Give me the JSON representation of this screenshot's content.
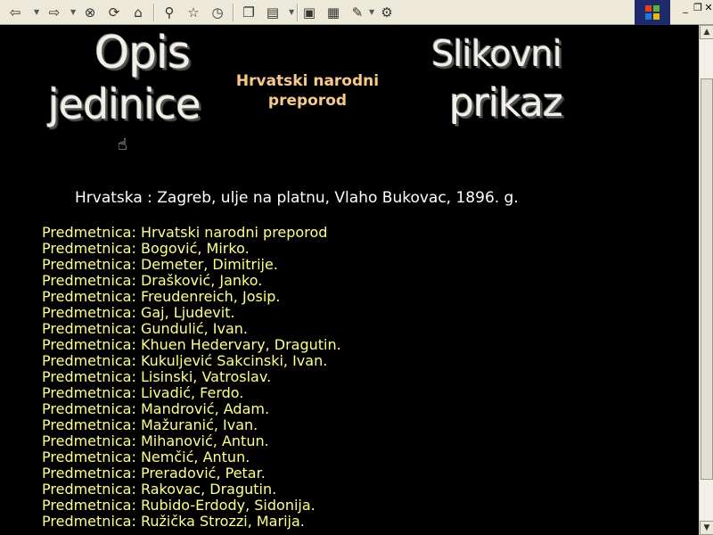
{
  "toolbar": {
    "buttons": [
      "back-icon",
      "forward-icon",
      "stop-icon",
      "refresh-icon",
      "home-icon",
      "search-icon",
      "favorites-icon",
      "history-icon",
      "copy-icon",
      "format-icon",
      "window-icon",
      "folder-icon",
      "edit-icon",
      "tools-icon"
    ]
  },
  "header": {
    "left_title_line1": "Opis",
    "left_title_line2": "jedinice",
    "center_title_line1": "Hrvatski narodni",
    "center_title_line2": "preporod",
    "right_title_line1": "Slikovni",
    "right_title_line2": "prikaz"
  },
  "description": "Hrvatska : Zagreb, ulje na platnu, Vlaho Bukovac, 1896. g.",
  "subjects": [
    "Predmetnica: Hrvatski narodni preporod",
    "Predmetnica: Bogović, Mirko.",
    "Predmetnica: Demeter, Dimitrije.",
    "Predmetnica: Drašković, Janko.",
    "Predmetnica: Freudenreich, Josip.",
    "Predmetnica: Gaj, Ljudevit.",
    "Predmetnica: Gundulić, Ivan.",
    "Predmetnica: Khuen Hedervary, Dragutin.",
    "Predmetnica: Kukuljević Sakcinski, Ivan.",
    "Predmetnica: Lisinski, Vatroslav.",
    "Predmetnica: Livadić, Ferdo.",
    "Predmetnica: Mandrović, Adam.",
    "Predmetnica: Mažuranić, Ivan.",
    "Predmetnica: Mihanović, Antun.",
    "Predmetnica: Nemčić, Antun.",
    "Predmetnica: Preradović, Petar.",
    "Predmetnica: Rakovac, Dragutin.",
    "Predmetnica: Rubido-Erdody, Sidonija.",
    "Predmetnica: Ružička Strozzi, Marija."
  ],
  "colors": {
    "background": "#000000",
    "subject_text": "#ffff8c",
    "center_title": "#f7c98b"
  }
}
